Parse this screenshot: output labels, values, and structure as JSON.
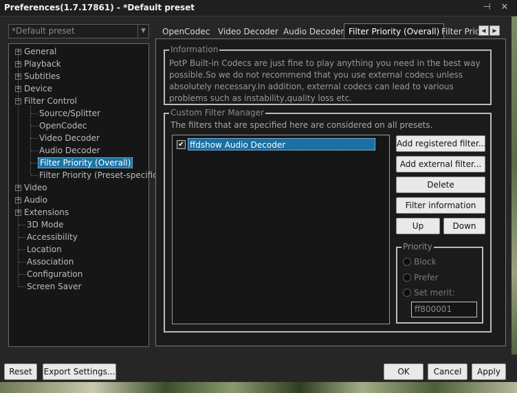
{
  "window": {
    "title": "Preferences(1.7.17861) - *Default preset",
    "pin_glyph": "⊣",
    "close_glyph": "✕"
  },
  "preset": {
    "selected": "*Default preset",
    "dropdown_glyph": "▼"
  },
  "tree": {
    "expand_glyph": "+",
    "collapse_glyph": "−",
    "items": [
      {
        "label": "General",
        "level": 0,
        "expandable": true
      },
      {
        "label": "Playback",
        "level": 0,
        "expandable": true
      },
      {
        "label": "Subtitles",
        "level": 0,
        "expandable": true
      },
      {
        "label": "Device",
        "level": 0,
        "expandable": true
      },
      {
        "label": "Filter Control",
        "level": 0,
        "expandable": true,
        "expanded": true
      },
      {
        "label": "Source/Splitter",
        "level": 1
      },
      {
        "label": "OpenCodec",
        "level": 1
      },
      {
        "label": "Video Decoder",
        "level": 1
      },
      {
        "label": "Audio Decoder",
        "level": 1
      },
      {
        "label": "Filter Priority (Overall)",
        "level": 1,
        "selected": true
      },
      {
        "label": "Filter Priority (Preset-specific)",
        "level": 1
      },
      {
        "label": "Video",
        "level": 0,
        "expandable": true
      },
      {
        "label": "Audio",
        "level": 0,
        "expandable": true
      },
      {
        "label": "Extensions",
        "level": 0,
        "expandable": true
      },
      {
        "label": "3D Mode",
        "level": 0
      },
      {
        "label": "Accessibility",
        "level": 0
      },
      {
        "label": "Location",
        "level": 0
      },
      {
        "label": "Association",
        "level": 0
      },
      {
        "label": "Configuration",
        "level": 0
      },
      {
        "label": "Screen Saver",
        "level": 0
      }
    ]
  },
  "tabs": {
    "items": [
      "OpenCodec",
      "Video Decoder",
      "Audio Decoder",
      "Filter Priority (Overall)",
      "Filter Prio"
    ],
    "active_index": 3,
    "scroll_left_glyph": "◀",
    "scroll_right_glyph": "▶"
  },
  "information": {
    "legend": "Information",
    "text": "PotP Built-in Codecs are just fine to play anything you need in the best way possible.So we do not recommend that you use external codecs unless absolutely necessary.In addition, external codecs can lead to various problems such as instability,quality loss etc."
  },
  "custom_filter_manager": {
    "legend": "Custom Filter Manager",
    "description": "The filters that are specified here are considered on all presets.",
    "filters": [
      {
        "name": "ffdshow Audio Decoder",
        "checked": true,
        "check_glyph": "✔"
      }
    ],
    "buttons": {
      "add_registered": "Add registered filter...",
      "add_external": "Add external filter...",
      "delete": "Delete",
      "filter_information": "Filter information",
      "up": "Up",
      "down": "Down"
    }
  },
  "priority": {
    "legend": "Priority",
    "options": [
      "Block",
      "Prefer",
      "Set merit:"
    ],
    "merit_value": "ff800001"
  },
  "bottom": {
    "reset": "Reset",
    "export_settings": "Export Settings...",
    "ok": "OK",
    "cancel": "Cancel",
    "apply": "Apply"
  },
  "colors": {
    "accent": "#1b73a7",
    "background": "#1b1b1b",
    "button": "#e9e9e9"
  }
}
